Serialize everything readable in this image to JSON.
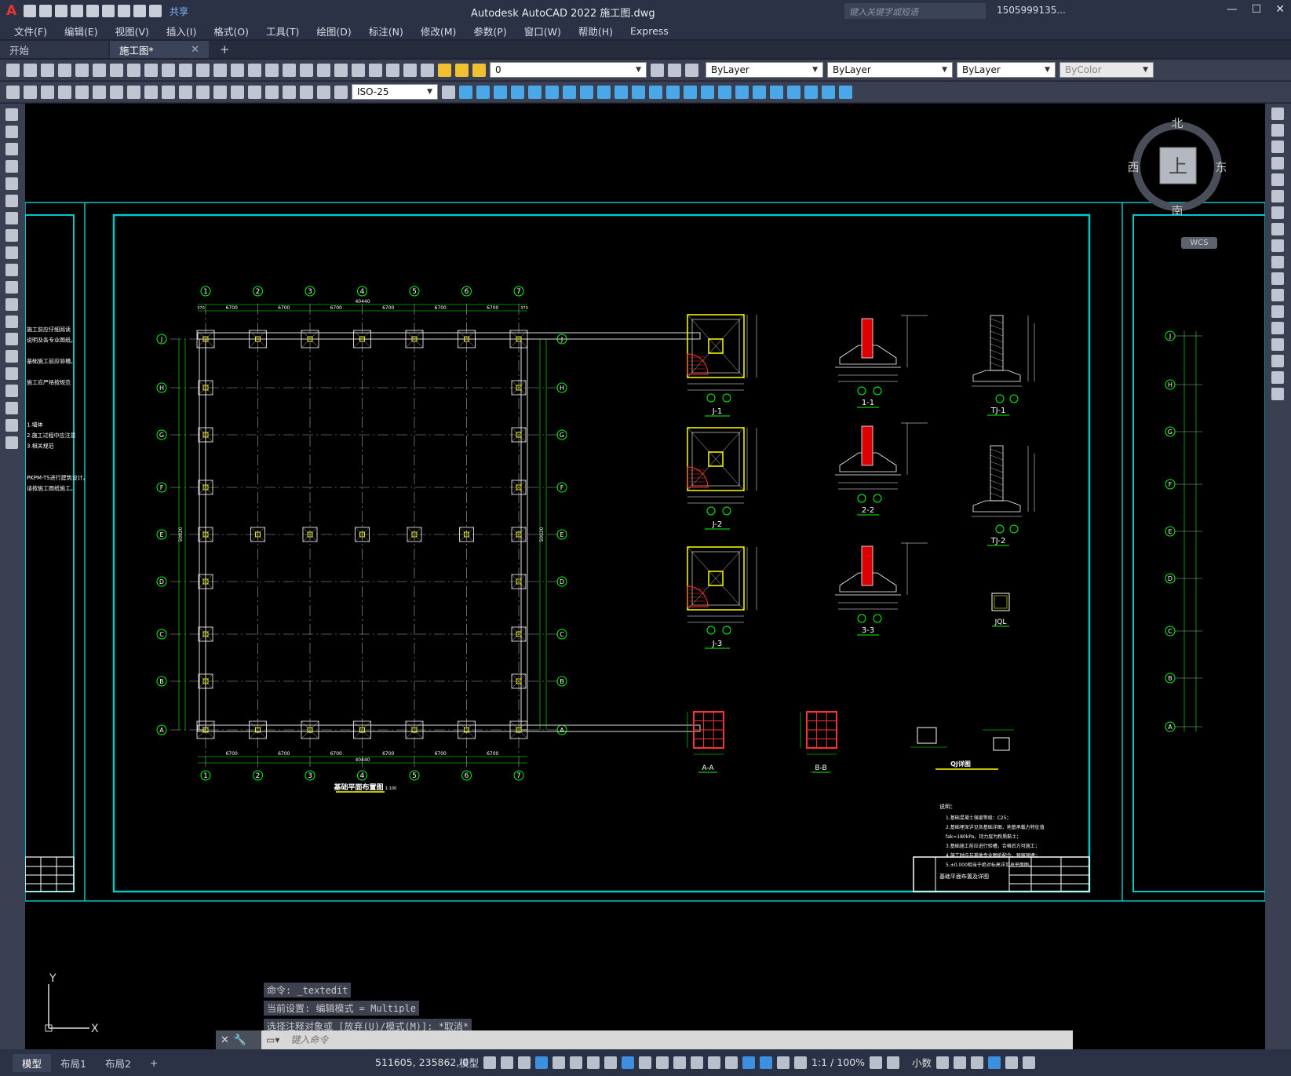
{
  "titlebar": {
    "logo": "A",
    "share": "共享",
    "title": "Autodesk AutoCAD 2022    施工图.dwg",
    "search_placeholder": "键入关键字或短语",
    "user": "1505999135...",
    "win_min": "—",
    "win_max": "☐",
    "win_close": "✕"
  },
  "menu": [
    "文件(F)",
    "编辑(E)",
    "视图(V)",
    "插入(I)",
    "格式(O)",
    "工具(T)",
    "绘图(D)",
    "标注(N)",
    "修改(M)",
    "参数(P)",
    "窗口(W)",
    "帮助(H)",
    "Express"
  ],
  "tabs": {
    "start": "开始",
    "drawing": "施工图*",
    "close": "✕",
    "add": "+"
  },
  "toolbar": {
    "layer_value": "0",
    "color": "ByLayer",
    "linetype": "ByLayer",
    "lineweight": "ByLayer",
    "plotstyle": "ByColor",
    "dimstyle": "ISO-25"
  },
  "viewcube": {
    "north": "北",
    "south": "南",
    "east": "东",
    "west": "西",
    "top": "上",
    "wcs": "WCS"
  },
  "drawing": {
    "axis_numbers": [
      "1",
      "2",
      "3",
      "4",
      "5",
      "6",
      "7"
    ],
    "axis_letters": [
      "J",
      "H",
      "G",
      "F",
      "E",
      "D",
      "C",
      "B",
      "A"
    ],
    "span_dim": "6700",
    "total_dim": "40440",
    "total_dim_v": "50020",
    "edge_dim": "370",
    "plan_title": "基础平面布置图",
    "plan_scale": "1:100",
    "detail_labels": [
      "J-1",
      "J-2",
      "J-3",
      "1-1",
      "2-2",
      "3-3",
      "TJ-1",
      "TJ-2",
      "JQL",
      "A-A",
      "B-B",
      "QJ详图"
    ],
    "notes_title": "说明：",
    "notes": [
      "1.基础混凝土强度等级：C25；",
      "2.基础埋深详见各基础详图，地基承载力特征值",
      "  fak=180kPa，持力层为粉质黏土；",
      "3.基础施工前应进行验槽，合格后方可施工；",
      "4.施工时应与其他专业图纸配合，预留预埋；",
      "5.±0.000相当于绝对标高详见总平面图。"
    ],
    "titleblock_text": "基础平面布置及详图",
    "left_notes": [
      "施工前应仔细阅读",
      "说明及各专业图纸。",
      "",
      "基础施工前应验槽。",
      "",
      "施工应严格按规范",
      "",
      "",
      "",
      "1.墙体",
      "2.施工过程中应注意",
      "3.相关规范",
      "",
      "",
      "PKPM-TS进行建筑设计。",
      "请按施工图纸施工。"
    ]
  },
  "command": {
    "history": [
      "命令: _textedit",
      "当前设置: 编辑模式 = Multiple",
      "选择注释对象或 [放弃(U)/模式(M)]: *取消*"
    ],
    "placeholder": "键入命令"
  },
  "ucs": {
    "y": "Y",
    "x": "X"
  },
  "status": {
    "tabs": [
      "模型",
      "布局1",
      "布局2"
    ],
    "add": "+",
    "coords": "511605, 235862, 0",
    "model": "模型",
    "scale": "1:1 / 100%",
    "units": "小数"
  }
}
